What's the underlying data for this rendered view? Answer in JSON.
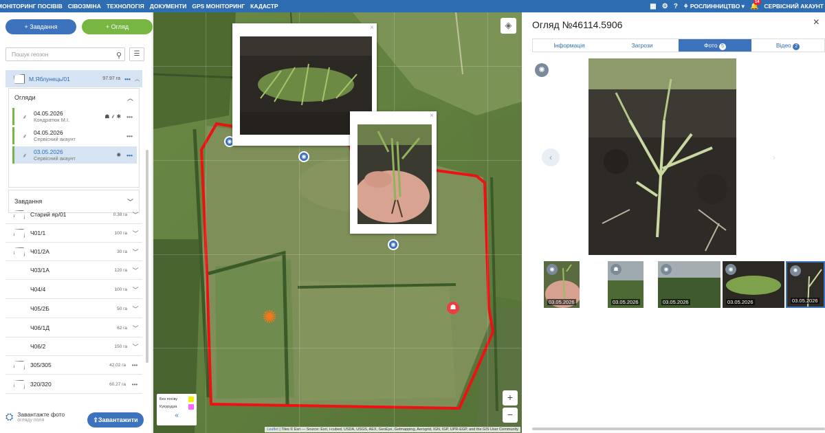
{
  "topbar": {
    "nav": [
      "МОНІТОРИНГ ПОСІВІВ",
      "СІВОЗМІНА",
      "ТЕХНОЛОГІЯ",
      "ДОКУМЕНТИ",
      "GPS МОНІТОРИНГ",
      "КАДАСТР"
    ],
    "crop_menu": "РОСЛИННИЦТВО",
    "notif_count": "14",
    "account": "СЕРВІСНИЙ АКАУНТ"
  },
  "sidebar": {
    "add_task": "+ Завдання",
    "add_inspection": "+ Огляд",
    "search_placeholder": "Пошук геозон",
    "selected_field": {
      "name": "М.Яблунець/01",
      "area": "97.97 га"
    },
    "inspections_header": "Огляди",
    "inspections": [
      {
        "date": "04.05.2026",
        "user": "Кондратюк М.І."
      },
      {
        "date": "04.05.2026",
        "user": "Сервісний акаунт"
      },
      {
        "date": "03.05.2026",
        "user": "Сервісний акаунт"
      }
    ],
    "tasks_header": "Завдання",
    "fields": [
      {
        "name": "Старий яр/01",
        "area": "0.38 га"
      },
      {
        "name": "Ч01/1",
        "area": "100 га"
      },
      {
        "name": "Ч01/2А",
        "area": "30 га"
      },
      {
        "name": "Ч03/1А",
        "area": "120 га"
      },
      {
        "name": "Ч04/4",
        "area": "100 га"
      },
      {
        "name": "Ч05/2Б",
        "area": "50 га"
      },
      {
        "name": "Ч06/1Д",
        "area": "62 га"
      },
      {
        "name": "Ч06/2",
        "area": "150 га"
      },
      {
        "name": "305/305",
        "area": "42.02 га"
      },
      {
        "name": "320/320",
        "area": "60.27 га"
      }
    ],
    "upload_title": "Завантажте фото",
    "upload_sub": "огляду поля",
    "upload_button": "Завантажити"
  },
  "map": {
    "legend": [
      {
        "label": "Без посіву",
        "color": "#f2f200"
      },
      {
        "label": "Кукурудза",
        "color": "#ff66ff"
      }
    ],
    "attribution_leaflet": "Leaflet",
    "attribution_rest": "| Tiles © Esri — Source: Esri, i-cubed, USDA, USGS, AEX, GeoEye, Getmapping, Aerogrid, IGN, IGP, UPR-EGP, and the GIS User Community"
  },
  "detail": {
    "title": "Огляд №46114.5906",
    "tabs": [
      {
        "label": "Інформація"
      },
      {
        "label": "Загрози"
      },
      {
        "label": "Фото",
        "badge": "5",
        "active": true
      },
      {
        "label": "Відео",
        "badge": "2"
      }
    ],
    "thumbnails": [
      {
        "date": "03.05.2026"
      },
      {
        "date": "03.05.2026"
      },
      {
        "date": "03.05.2026"
      },
      {
        "date": "03.05.2026"
      },
      {
        "date": "03.05.2026"
      }
    ]
  }
}
